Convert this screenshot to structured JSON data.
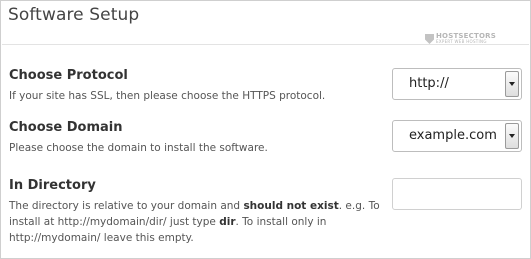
{
  "header": {
    "title": "Software Setup",
    "watermark_main": "HOSTSECTORS",
    "watermark_sub": "EXPERT WEB HOSTING"
  },
  "protocol": {
    "label": "Choose Protocol",
    "help": "If your site has SSL, then please choose the HTTPS protocol.",
    "selected": "http://"
  },
  "domain": {
    "label": "Choose Domain",
    "help": "Please choose the domain to install the software.",
    "selected": "example.com"
  },
  "directory": {
    "label": "In Directory",
    "help_1": "The directory is relative to your domain and ",
    "help_2": "should not exist",
    "help_3": ". e.g. To install at http://mydomain/dir/ just type ",
    "help_4": "dir",
    "help_5": ". To install only in http://mydomain/ leave this empty.",
    "value": ""
  }
}
